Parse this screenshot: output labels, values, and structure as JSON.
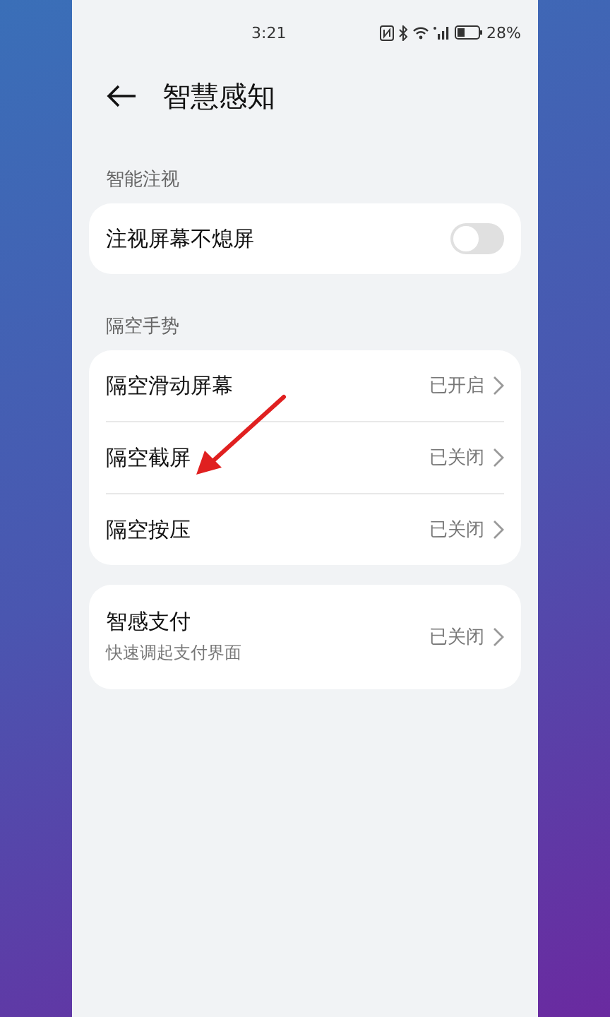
{
  "status_bar": {
    "time": "3:21",
    "battery_text": "28%"
  },
  "header": {
    "title": "智慧感知"
  },
  "sections": [
    {
      "label": "智能注视",
      "items": [
        {
          "kind": "toggle",
          "title": "注视屏幕不熄屏",
          "on": false
        }
      ]
    },
    {
      "label": "隔空手势",
      "items": [
        {
          "kind": "link",
          "title": "隔空滑动屏幕",
          "value": "已开启"
        },
        {
          "kind": "link",
          "title": "隔空截屏",
          "value": "已关闭"
        },
        {
          "kind": "link",
          "title": "隔空按压",
          "value": "已关闭"
        }
      ]
    },
    {
      "items": [
        {
          "kind": "link",
          "title": "智感支付",
          "subtitle": "快速调起支付界面",
          "value": "已关闭"
        }
      ]
    }
  ]
}
